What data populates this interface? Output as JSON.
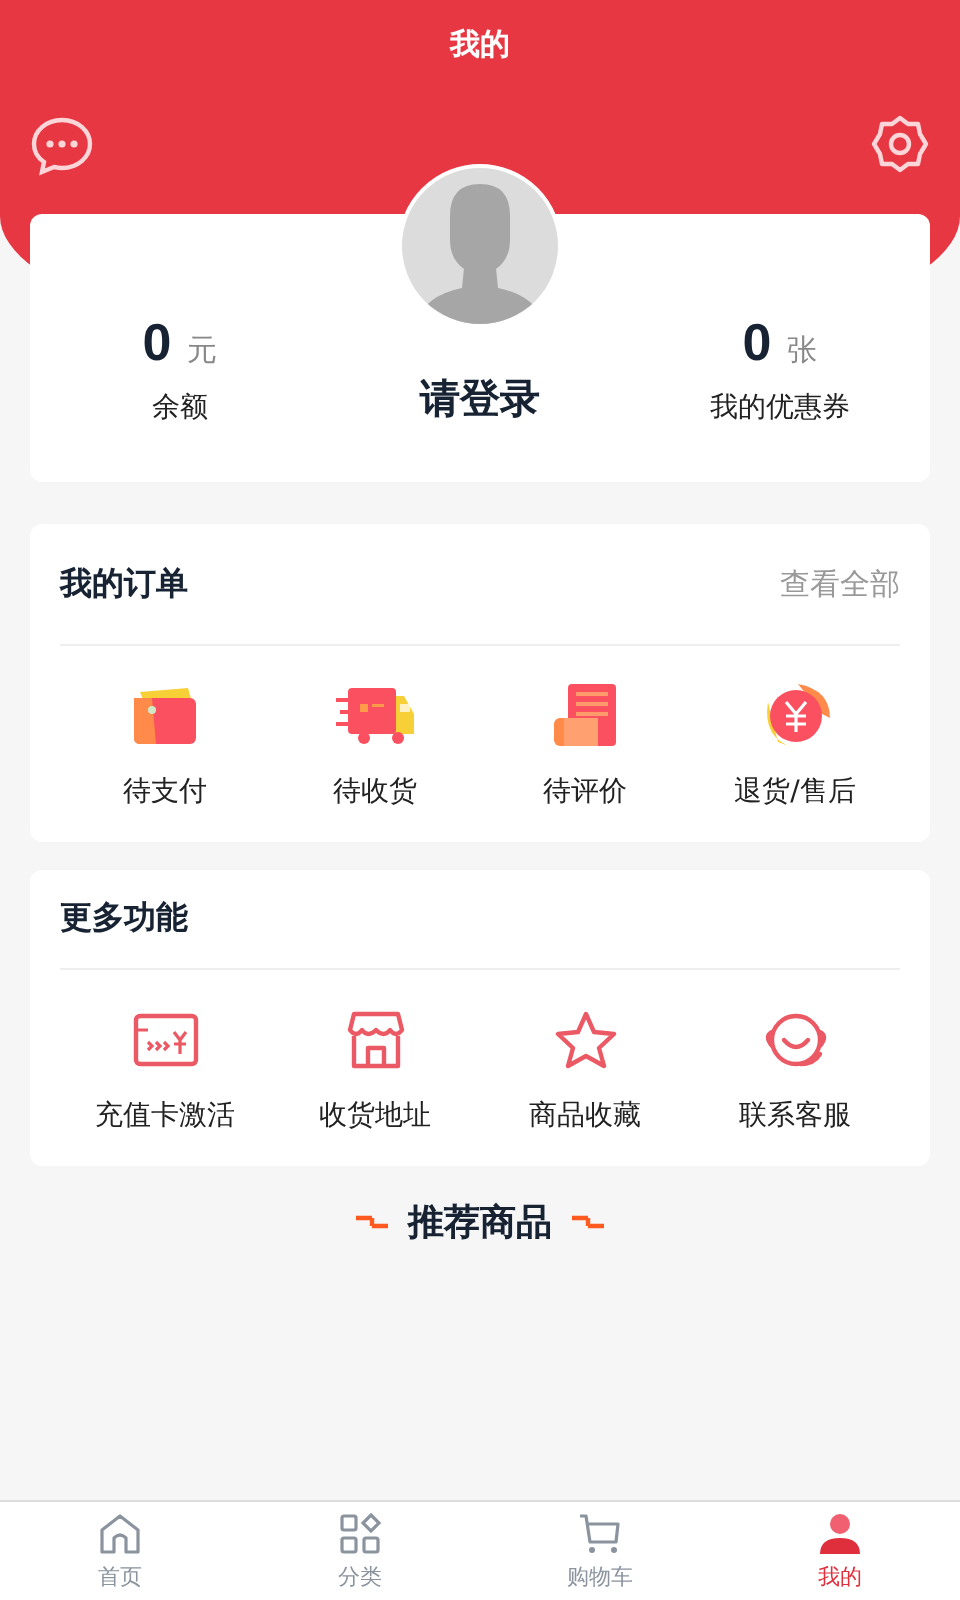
{
  "header": {
    "title": "我的"
  },
  "profile": {
    "balance": {
      "value": "0",
      "unit": "元",
      "label": "余额"
    },
    "login": "请登录",
    "coupons": {
      "value": "0",
      "unit": "张",
      "label": "我的优惠券"
    }
  },
  "orders": {
    "title": "我的订单",
    "link": "查看全部",
    "items": [
      {
        "label": "待支付",
        "kind": "wallet"
      },
      {
        "label": "待收货",
        "kind": "truck"
      },
      {
        "label": "待评价",
        "kind": "receipt"
      },
      {
        "label": "退货/售后",
        "kind": "refund"
      }
    ]
  },
  "more": {
    "title": "更多功能",
    "items": [
      {
        "label": "充值卡激活",
        "kind": "card"
      },
      {
        "label": "收货地址",
        "kind": "store"
      },
      {
        "label": "商品收藏",
        "kind": "star"
      },
      {
        "label": "联系客服",
        "kind": "headset"
      }
    ]
  },
  "recommend": {
    "title": "推荐商品"
  },
  "tabs": [
    {
      "label": "首页",
      "kind": "home",
      "selected": false
    },
    {
      "label": "分类",
      "kind": "grid",
      "selected": false
    },
    {
      "label": "购物车",
      "kind": "cart",
      "selected": false
    },
    {
      "label": "我的",
      "kind": "person",
      "selected": true
    }
  ]
}
